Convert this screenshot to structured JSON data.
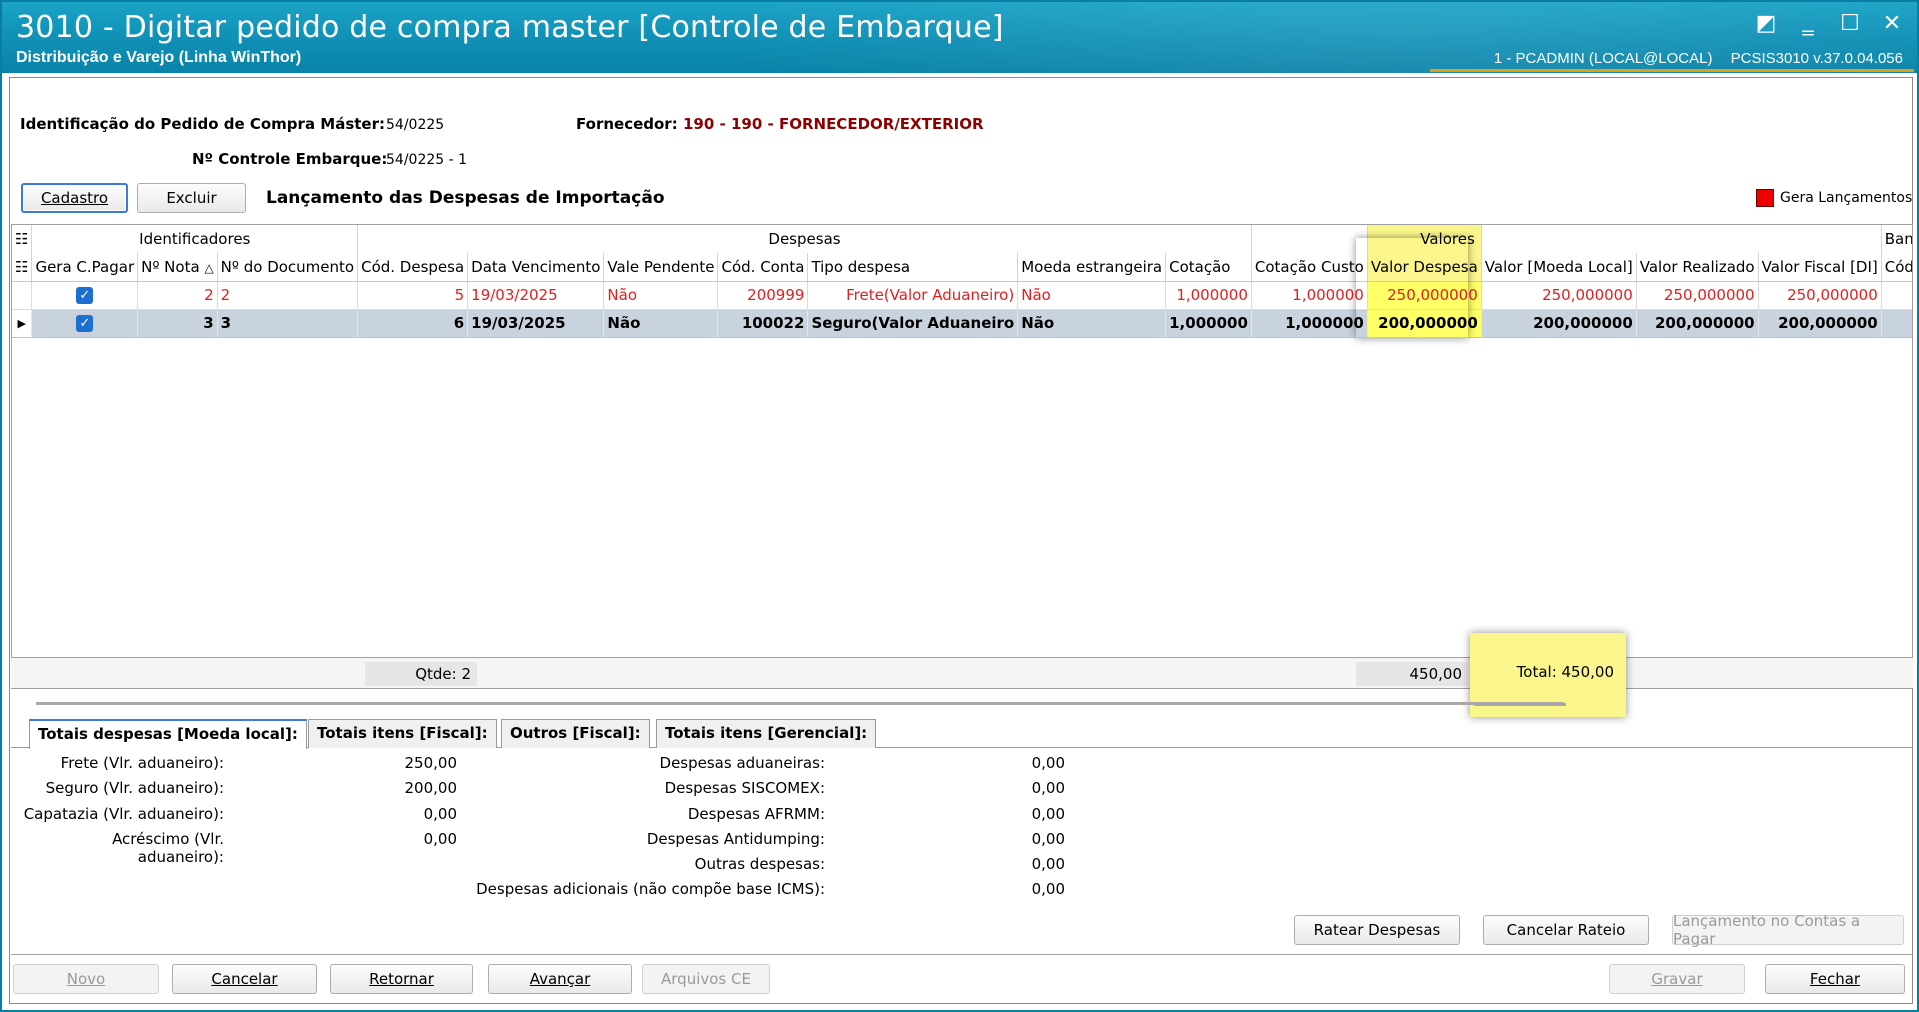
{
  "window": {
    "title": "3010 - Digitar pedido de compra master [Controle de Embarque]",
    "subtitle": "Distribuição e Varejo (Linha WinThor)",
    "user": "1 - PCADMIN (LOCAL@LOCAL)",
    "version": "PCSIS3010  v.37.0.04.056"
  },
  "header": {
    "id_label": "Identificação do Pedido de Compra Máster:",
    "id_value": "54/0225",
    "fornecedor_label": "Fornecedor:",
    "fornecedor_value": "190 - 190 - FORNECEDOR/EXTERIOR",
    "controle_label": "Nº Controle Embarque:",
    "controle_value": "54/0225 - 1"
  },
  "toolbar": {
    "cadastro": "Cadastro",
    "excluir": "Excluir",
    "section_title": "Lançamento das Despesas de Importação",
    "legend_label": "Gera Lançamentos"
  },
  "grid": {
    "bands": [
      "Identificadores",
      "Despesas",
      "Valores",
      "Banc"
    ],
    "columns": [
      "Gera C.Pagar",
      "Nº Nota",
      "Nº do Documento",
      "Cód. Despesa",
      "Data Vencimento",
      "Vale Pendente",
      "Cód. Conta",
      "Tipo despesa",
      "Moeda estrangeira",
      "Cotação",
      "Cotação Custo",
      "Valor Despesa",
      "Valor [Moeda Local]",
      "Valor Realizado",
      "Valor Fiscal [DI]",
      "Cód. Ba"
    ],
    "sort_glyph": "△",
    "rows": [
      {
        "nota": "2",
        "doc": "2",
        "cod_desp": "5",
        "venc": "19/03/2025",
        "pend": "Não",
        "conta": "200999",
        "tipo": "Frete(Valor Aduaneiro)",
        "moeda": "Não",
        "cot": "1,000000",
        "cot_custo": "1,000000",
        "valor": "250,000000",
        "local": "250,000000",
        "realizado": "250,000000",
        "fiscal": "250,000000"
      },
      {
        "nota": "3",
        "doc": "3",
        "cod_desp": "6",
        "venc": "19/03/2025",
        "pend": "Não",
        "conta": "100022",
        "tipo": "Seguro(Valor Aduaneiro",
        "moeda": "Não",
        "cot": "1,000000",
        "cot_custo": "1,000000",
        "valor": "200,000000",
        "local": "200,000000",
        "realizado": "200,000000",
        "fiscal": "200,000000"
      }
    ],
    "footer_qtde": "Qtde: 2",
    "footer_sum": "450,00",
    "footer_total": "Total: 450,00"
  },
  "tabs": [
    "Totais despesas [Moeda local]:",
    "Totais itens [Fiscal]:",
    "Outros [Fiscal]:",
    "Totais itens [Gerencial]:"
  ],
  "totals_left": [
    {
      "label": "Frete (Vlr. aduaneiro):",
      "value": "250,00"
    },
    {
      "label": "Seguro (Vlr. aduaneiro):",
      "value": "200,00"
    },
    {
      "label": "Capatazia (Vlr. aduaneiro):",
      "value": "0,00"
    },
    {
      "label": "Acréscimo (Vlr. aduaneiro):",
      "value": "0,00"
    }
  ],
  "totals_right": [
    {
      "label": "Despesas aduaneiras:",
      "value": "0,00"
    },
    {
      "label": "Despesas SISCOMEX:",
      "value": "0,00"
    },
    {
      "label": "Despesas AFRMM:",
      "value": "0,00"
    },
    {
      "label": "Despesas Antidumping:",
      "value": "0,00"
    },
    {
      "label": "Outras despesas:",
      "value": "0,00"
    },
    {
      "label": "Despesas adicionais (não compõe base ICMS):",
      "value": "0,00"
    }
  ],
  "actions": {
    "ratear": "Ratear Despesas",
    "cancelar_rateio": "Cancelar Rateio",
    "lancamento": "Lançamento no Contas a Pagar"
  },
  "footer_buttons": {
    "novo": "Novo",
    "cancelar": "Cancelar",
    "retornar": "Retornar",
    "avancar": "Avançar",
    "arquivos": "Arquivos CE",
    "gravar": "Gravar",
    "fechar": "Fechar"
  },
  "colors": {
    "titlebar": "#0f8fb5",
    "highlight": "#fbf68c",
    "row_red": "#e02020",
    "selected_row": "#c8d3de"
  }
}
